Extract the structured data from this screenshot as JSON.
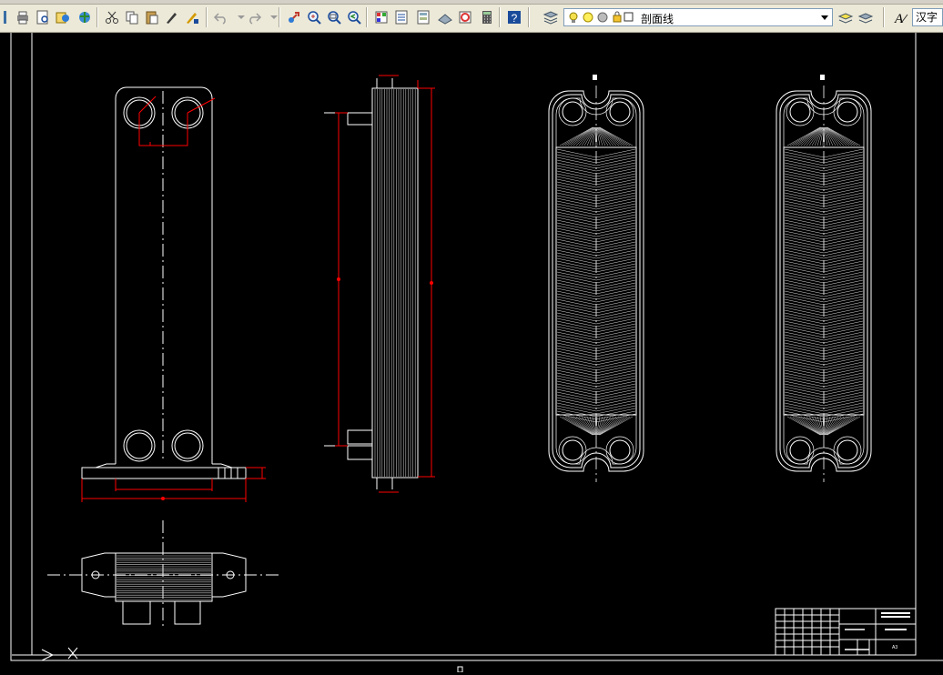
{
  "toolbar": {
    "layer_name": "剖面线",
    "text_style": "汉字"
  },
  "drawing": {
    "sheet_size_label": "A3"
  },
  "colors": {
    "background": "#000000",
    "lines": "#ffffff",
    "dimensions": "#ff0000",
    "toolbar": "#ece9d8"
  }
}
